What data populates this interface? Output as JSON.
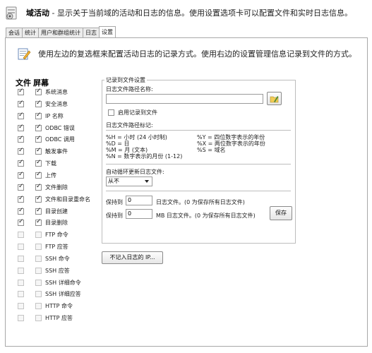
{
  "header": {
    "title": "域活动",
    "description": " - 显示关于当前域的活动和日志的信息。使用设置选项卡可以配置文件和实时日志信息。"
  },
  "tabs": [
    {
      "label": "会话"
    },
    {
      "label": "统计"
    },
    {
      "label": "用户和群组统计"
    },
    {
      "label": "日志"
    },
    {
      "label": "设置"
    }
  ],
  "intro": "使用左边的复选框来配置活动日志的记录方式。使用右边的设置管理信息记录到文件的方式。",
  "columns": {
    "file": "文件",
    "screen": "屏幕"
  },
  "log_items": [
    {
      "label": "系统消息",
      "file": true,
      "screen": true
    },
    {
      "label": "安全消息",
      "file": true,
      "screen": true
    },
    {
      "label": "IP 名称",
      "file": true,
      "screen": true
    },
    {
      "label": "ODBC 错误",
      "file": true,
      "screen": true
    },
    {
      "label": "ODBC 调用",
      "file": true,
      "screen": true
    },
    {
      "label": "触发事件",
      "file": true,
      "screen": true
    },
    {
      "label": "下载",
      "file": true,
      "screen": true
    },
    {
      "label": "上传",
      "file": true,
      "screen": true
    },
    {
      "label": "文件删除",
      "file": true,
      "screen": true
    },
    {
      "label": "文件和目录重命名",
      "file": true,
      "screen": true
    },
    {
      "label": "目录创建",
      "file": true,
      "screen": true
    },
    {
      "label": "目录删除",
      "file": true,
      "screen": true
    },
    {
      "label": "FTP 命令",
      "file": false,
      "screen": false
    },
    {
      "label": "FTP 应答",
      "file": false,
      "screen": false
    },
    {
      "label": "SSH 命令",
      "file": false,
      "screen": false
    },
    {
      "label": "SSH 应答",
      "file": false,
      "screen": false
    },
    {
      "label": "SSH 详细命令",
      "file": false,
      "screen": false
    },
    {
      "label": "SSH 详细应答",
      "file": false,
      "screen": false
    },
    {
      "label": "HTTP 命令",
      "file": false,
      "screen": false
    },
    {
      "label": "HTTP 应答",
      "file": false,
      "screen": false
    }
  ],
  "settings": {
    "legend": "记录到文件设置",
    "path_label": "日志文件路径名称:",
    "path_value": "",
    "enable_label": "启用记录到文件",
    "enable_checked": false,
    "tokens_title": "日志文件路径标记:",
    "tokens_left": [
      "%H = 小时 (24 小时制)",
      "%D = 日",
      "%M = 月 (文本)",
      "%N = 数字表示的月份 (1-12)"
    ],
    "tokens_right": [
      "%Y = 四位数字表示的年份",
      "%X = 两位数字表示的年份",
      "%S = 域名"
    ],
    "rotate_label": "自动循环更新日志文件:",
    "rotate_value": "从不",
    "keep_prefix": "保持到",
    "keep_files_value": "0",
    "keep_files_suffix": "日志文件。(0 为保存所有日志文件)",
    "keep_mb_value": "0",
    "keep_mb_suffix": "MB 日志文件。(0 为保存所有日志文件)",
    "save_label": "保存"
  },
  "no_log_ip_label": "不记入日志的 IP..."
}
